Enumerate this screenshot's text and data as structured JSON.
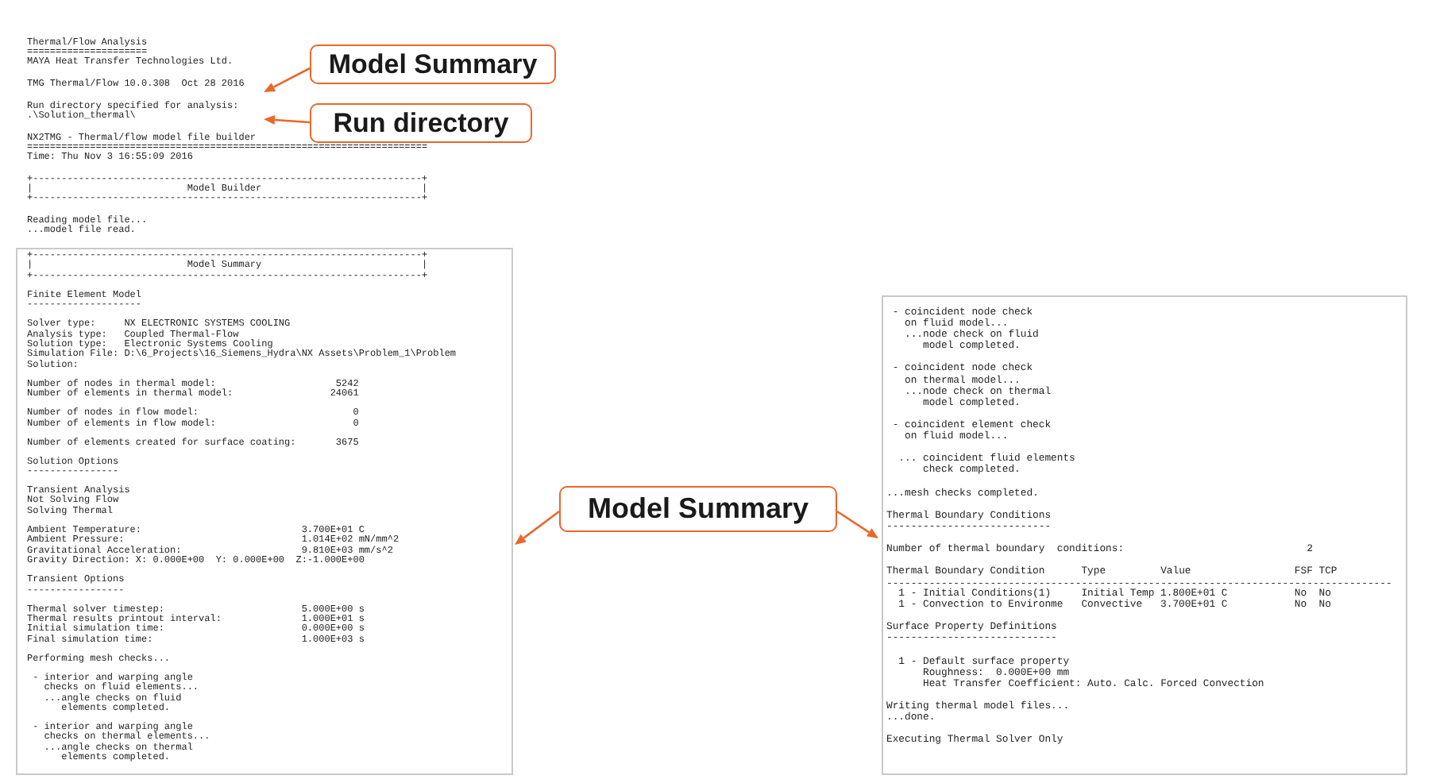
{
  "top_log": {
    "blocks": [
      {
        "kind": "text",
        "lines": [
          "Thermal/Flow Analysis",
          "=====================",
          "MAYA Heat Transfer Technologies Ltd."
        ]
      },
      {
        "kind": "text",
        "lines": [
          "TMG Thermal/Flow 10.0.308  Oct 28 2016"
        ]
      },
      {
        "kind": "text",
        "lines": [
          "Run directory specified for analysis:",
          ".\\Solution_thermal\\"
        ]
      },
      {
        "kind": "text",
        "lines": [
          "NX2TMG - Thermal/flow model file builder",
          "======================================================================",
          "Time: Thu Nov 3 16:55:09 2016"
        ]
      },
      {
        "kind": "text",
        "lines": [
          "+--------------------------------------------------------------------+",
          "|                           Model Builder                            |",
          "+--------------------------------------------------------------------+"
        ]
      },
      {
        "kind": "text",
        "lines": [
          "Reading model file...",
          "...model file read."
        ]
      }
    ]
  },
  "left_panel": {
    "blocks": [
      {
        "kind": "text",
        "lines": [
          "+--------------------------------------------------------------------+",
          "|                           Model Summary                            |",
          "+--------------------------------------------------------------------+"
        ]
      },
      {
        "kind": "text",
        "lines": [
          "Finite Element Model",
          "--------------------"
        ]
      },
      {
        "kind": "fields",
        "rows": [
          {
            "label": "Solver type:",
            "value": "NX ELECTRONIC SYSTEMS COOLING"
          },
          {
            "label": "Analysis type:",
            "value": "Coupled Thermal-Flow"
          },
          {
            "label": "Solution type:",
            "value": "Electronic Systems Cooling"
          },
          {
            "label": "Simulation File:",
            "value": "D:\\6_Projects\\16_Siemens_Hydra\\NX Assets\\Problem_1\\Problem"
          },
          "Solution:"
        ]
      },
      {
        "kind": "counts",
        "rows": [
          {
            "label": "Number of nodes in thermal model:",
            "value": "5242"
          },
          {
            "label": "Number of elements in thermal model:",
            "value": "24061"
          }
        ]
      },
      {
        "kind": "counts",
        "rows": [
          {
            "label": "Number of nodes in flow model:",
            "value": "0"
          },
          {
            "label": "Number of elements in flow model:",
            "value": "0"
          }
        ]
      },
      {
        "kind": "counts",
        "rows": [
          {
            "label": "Number of elements created for surface coating:",
            "value": "3675"
          }
        ]
      },
      {
        "kind": "text",
        "lines": [
          "Solution Options",
          "----------------"
        ]
      },
      {
        "kind": "text",
        "lines": [
          "Transient Analysis",
          "Not Solving Flow",
          "Solving Thermal"
        ]
      },
      {
        "kind": "settings",
        "rows": [
          {
            "label": "Ambient Temperature:",
            "value": "3.700E+01 C"
          },
          {
            "label": "Ambient Pressure:",
            "value": "1.014E+02 mN/mm^2"
          },
          {
            "label": "Gravitational Acceleration:",
            "value": "9.810E+03 mm/s^2"
          },
          "Gravity Direction: X: 0.000E+00  Y: 0.000E+00  Z:-1.000E+00"
        ]
      },
      {
        "kind": "text",
        "lines": [
          "Transient Options",
          "-----------------"
        ]
      },
      {
        "kind": "settings",
        "rows": [
          {
            "label": "Thermal solver timestep:",
            "value": "5.000E+00 s"
          },
          {
            "label": "Thermal results printout interval:",
            "value": "1.000E+01 s"
          },
          {
            "label": "Initial simulation time:",
            "value": "0.000E+00 s"
          },
          {
            "label": "Final simulation time:",
            "value": "1.000E+03 s"
          }
        ]
      },
      {
        "kind": "text",
        "lines": [
          "Performing mesh checks..."
        ]
      },
      {
        "kind": "text",
        "lines": [
          " - interior and warping angle",
          "   checks on fluid elements...",
          "   ...angle checks on fluid",
          "      elements completed."
        ]
      },
      {
        "kind": "text",
        "lines": [
          " - interior and warping angle",
          "   checks on thermal elements...",
          "   ...angle checks on thermal",
          "      elements completed."
        ]
      }
    ]
  },
  "right_panel": {
    "blocks": [
      {
        "kind": "text",
        "lines": [
          " - coincident node check",
          "   on fluid model...",
          "   ...node check on fluid",
          "      model completed."
        ]
      },
      {
        "kind": "text",
        "lines": [
          " - coincident node check",
          "   on thermal model...",
          "   ...node check on thermal",
          "      model completed."
        ]
      },
      {
        "kind": "text",
        "lines": [
          " - coincident element check",
          "   on fluid model..."
        ]
      },
      {
        "kind": "text",
        "lines": [
          "  ... coincident fluid elements",
          "      check completed."
        ]
      },
      {
        "kind": "text",
        "lines": [
          "...mesh checks completed."
        ]
      },
      {
        "kind": "text",
        "lines": [
          "Thermal Boundary Conditions",
          "---------------------------"
        ]
      },
      {
        "kind": "counts_wide",
        "rows": [
          {
            "label": "Number of thermal boundary  conditions:",
            "value": "2"
          }
        ]
      },
      {
        "kind": "table",
        "columns": [
          "Thermal Boundary Condition",
          "Type",
          "Value",
          "FSF",
          "TCP"
        ],
        "rule": "-----------------------------------------------------------------------------------",
        "rows": [
          [
            "1 - Initial Conditions(1)",
            "Initial Temp",
            "1.800E+01 C",
            "No",
            "No"
          ],
          [
            "1 - Convection to Environme",
            "Convective",
            "3.700E+01 C",
            "No",
            "No"
          ]
        ]
      },
      {
        "kind": "text",
        "lines": [
          "Surface Property Definitions",
          "----------------------------"
        ]
      },
      {
        "kind": "text",
        "lines": [
          "  1 - Default surface property",
          "      Roughness:  0.000E+00 mm",
          "      Heat Transfer Coefficient: Auto. Calc. Forced Convection"
        ]
      },
      {
        "kind": "text",
        "lines": [
          "Writing thermal model files...",
          "...done."
        ]
      },
      {
        "kind": "text",
        "lines": [
          "Executing Thermal Solver Only"
        ]
      }
    ]
  },
  "callouts": [
    {
      "label": "Model Summary"
    },
    {
      "label": "Run directory"
    },
    {
      "label": "Model Summary"
    }
  ]
}
